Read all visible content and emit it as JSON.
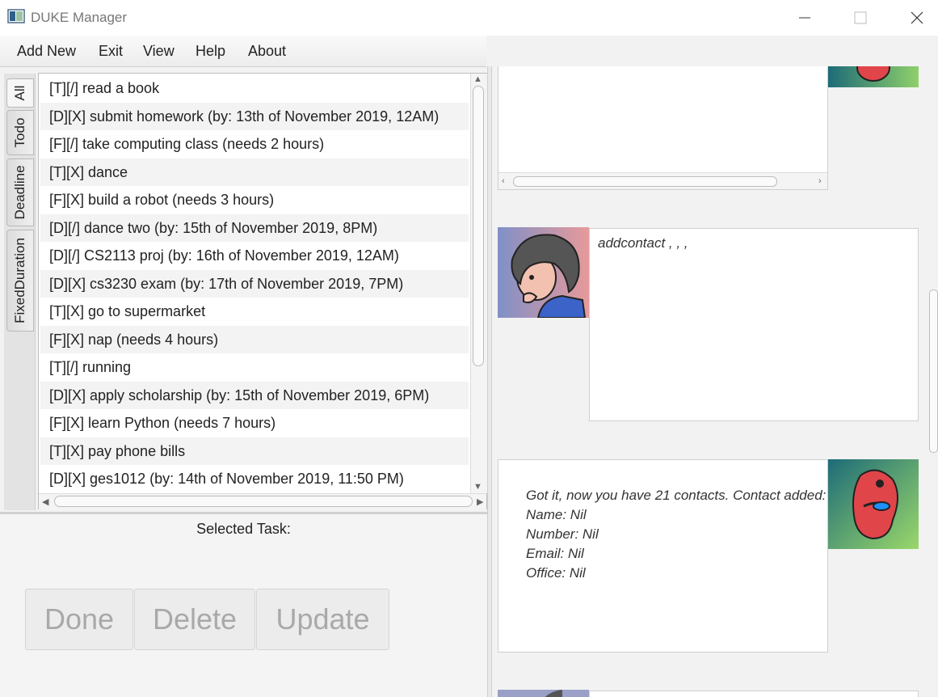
{
  "window": {
    "title": "DUKE Manager"
  },
  "menu": {
    "items": [
      "Add New",
      "Exit",
      "View",
      "Help",
      "About"
    ]
  },
  "tabs": [
    "All",
    "Todo",
    "Deadline",
    "FixedDuration"
  ],
  "tasks": [
    "[T][/] read a book",
    "[D][X] submit homework (by: 13th of November 2019, 12AM)",
    "[F][/] take computing class (needs 2 hours)",
    "[T][X] dance",
    "[F][X] build a robot (needs 3 hours)",
    "[D][/] dance two (by: 15th of November 2019, 8PM)",
    "[D][/] CS2113 proj (by: 16th of November 2019, 12AM)",
    "[D][X] cs3230 exam (by: 17th of November 2019, 7PM)",
    "[T][X] go to supermarket",
    "[F][X] nap (needs 4 hours)",
    "[T][/] running",
    "[D][X] apply scholarship (by: 15th of November 2019, 6PM)",
    "[F][X] learn Python (needs 7 hours)",
    "[T][X] pay phone bills",
    "[D][X] ges1012 (by: 14th of November 2019, 11:50 PM)"
  ],
  "selected_task_label": "Selected Task:",
  "buttons": {
    "done": "Done",
    "delete": "Delete",
    "update": "Update"
  },
  "chat": {
    "user_command": "addcontact , , ,",
    "bot_reply": [
      "Got it, now you have 21 contacts. Contact added:",
      "Name: Nil",
      "Number: Nil",
      "Email: Nil",
      "Office: Nil"
    ]
  }
}
